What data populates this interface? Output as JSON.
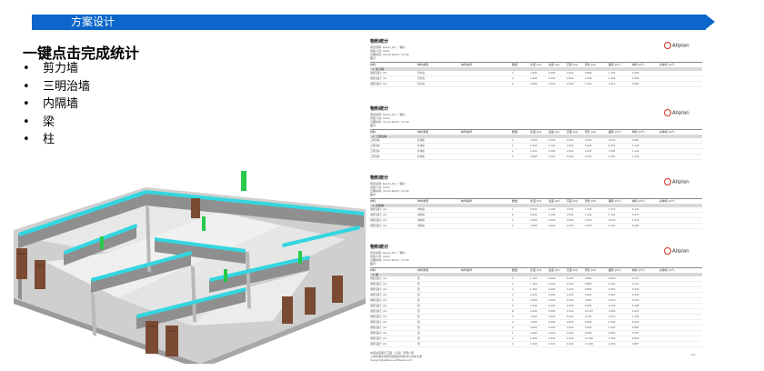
{
  "header": {
    "title": "方案设计",
    "color": "#0d66c9"
  },
  "main": {
    "heading": "一键点击完成统计",
    "bullets": [
      "剪力墙",
      "三明治墙",
      "内隔墙",
      "梁",
      "柱"
    ]
  },
  "render": {
    "description_icon": "building-3d-render"
  },
  "report": {
    "brand": "Allplan",
    "sections": [
      {
        "title": "物料统计",
        "meta": [
          "项目名称:  Demo_PC_一期六",
          "创建人员:  linxin",
          "日期时间:  10.12.2022  /  13:32",
          "图示:"
        ],
        "group": "4:  剪刀墙",
        "rows": [
          [
            "钢筋混凝土 (m)",
            "剪力墙",
            "2",
            "4.400",
            "0.200",
            "2.920",
            "0.880",
            "1.125",
            "4.228"
          ],
          [
            "钢筋混凝土 (m)",
            "剪力墙",
            "2",
            "4.400",
            "0.200",
            "2.920",
            "1.068",
            "1.069",
            "0.336"
          ],
          [
            "钢筋混凝土 (m)",
            "剪力墙",
            "6",
            "6.600",
            "0.200",
            "2.920",
            "1.200",
            "4.312",
            "0.962"
          ]
        ]
      },
      {
        "title": "物料统计",
        "meta": [
          "项目名称:  Demo_PC_一期六",
          "创建人员:  linxin",
          "日期时间:  10.12.2022  /  13:32",
          "图示:"
        ],
        "group": "4:  三明治墙",
        "rows": [
          [
            "三明治墙",
            "外墙板",
            "1",
            "2.000",
            "0.160",
            "2.920",
            "4.020",
            "2.635",
            "0.662"
          ],
          [
            "三明治墙",
            "外墙板",
            "1",
            "2.440",
            "0.160",
            "2.920",
            "5.068",
            "6.351",
            "1.126"
          ],
          [
            "三明治墙",
            "外墙板",
            "1",
            "2.201",
            "0.160",
            "2.920",
            "0.323",
            "7.094",
            "1.120"
          ],
          [
            "三明治墙",
            "外墙板",
            "1",
            "2.660",
            "0.160",
            "2.940",
            "5.426",
            "1.991",
            "1.174"
          ]
        ]
      },
      {
        "title": "物料统计",
        "meta": [
          "项目名称:  Demo_PC_一期六",
          "创建人员:  linxin",
          "日期时间:  10.12.2022  /  13:32",
          "图示:"
        ],
        "group": "4:  内隔墙",
        "rows": [
          [
            "钢筋混凝土 (m)",
            "内隔墙",
            "1",
            "0.600",
            "0.190",
            "2.632",
            "1.200",
            "1.470",
            "0.141"
          ],
          [
            "钢筋混凝土 (m)",
            "内隔墙",
            "8",
            "0.640",
            "0.190",
            "2.926",
            "1.440",
            "6.762",
            "0.476"
          ],
          [
            "钢筋混凝土 (m)",
            "内隔墙",
            "2",
            "0.660",
            "0.200",
            "2.920",
            "2.300",
            "3.676",
            "1.076"
          ],
          [
            "钢筋混凝土 (m)",
            "内隔墙",
            "1",
            "1.000",
            "0.200",
            "2.920",
            "2.300",
            "1.020",
            "0.184"
          ]
        ]
      },
      {
        "title": "物料统计",
        "meta": [
          "项目名称:  Demo_PC_一期六",
          "创建人员:  linxin",
          "日期时间:  10.12.2022  /  13:32",
          "图示:"
        ],
        "group": "4:  梁",
        "rows": [
          [
            "钢筋混凝土 (m)",
            "梁",
            "2",
            "1.100",
            "0.200",
            "0.420",
            "0.880",
            "0.050",
            "0.277"
          ],
          [
            "钢筋混凝土 (m)",
            "梁",
            "2",
            "1.300",
            "0.200",
            "0.420",
            "0.880",
            "0.160",
            "0.123"
          ],
          [
            "钢筋混凝土 (m)",
            "梁",
            "2",
            "1.400",
            "0.200",
            "0.420",
            "0.880",
            "0.450",
            "0.243"
          ],
          [
            "钢筋混凝土 (m)",
            "梁",
            "2",
            "2.000",
            "0.200",
            "0.420",
            "4.400",
            "0.660",
            "0.336"
          ],
          [
            "钢筋混凝土 (m)",
            "梁",
            "2",
            "2.000",
            "0.200",
            "0.420",
            "4.600",
            "0.420",
            "0.340"
          ],
          [
            "钢筋混凝土 (m)",
            "梁",
            "2",
            "3.200",
            "0.200",
            "0.420",
            "4.600",
            "2.440",
            "1.186"
          ],
          [
            "钢筋混凝土 (m)",
            "梁",
            "8",
            "2.640",
            "0.200",
            "0.420",
            "12.167",
            "4.560",
            "1.615"
          ],
          [
            "钢筋混凝土 (m)",
            "梁",
            "2",
            "3.300",
            "0.200",
            "0.420",
            "4.795",
            "3.520",
            "1.394"
          ],
          [
            "钢筋混凝土 (m)",
            "梁",
            "2",
            "3.200",
            "0.200",
            "0.420",
            "5.600",
            "1.590",
            "0.546"
          ],
          [
            "钢筋混凝土 (m)",
            "梁",
            "2",
            "3.600",
            "0.200",
            "0.420",
            "6.200",
            "1.090",
            "0.664"
          ],
          [
            "钢筋混凝土 (m)",
            "梁",
            "1",
            "4.200",
            "0.200",
            "0.420",
            "6.300",
            "0.450",
            "0.357"
          ],
          [
            "钢筋混凝土 (m)",
            "梁",
            "2",
            "3.400",
            "0.200",
            "0.420",
            "11.300",
            "2.160",
            "0.816"
          ],
          [
            "钢筋混凝土 (m)",
            "梁",
            "2",
            "6.340",
            "0.200",
            "0.420",
            "11.300",
            "2.360",
            "0.887"
          ]
        ]
      }
    ],
    "footer": [
      "内蒙古铝架行工程（上海）有限公司",
      "上海市浦东新区科技园区创新中心高新大厦",
      "Support@allplan-software.com"
    ],
    "page": "1/1"
  }
}
